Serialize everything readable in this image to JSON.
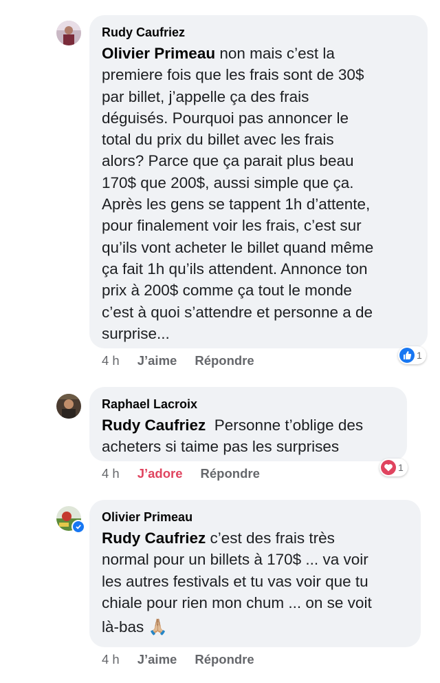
{
  "comments": [
    {
      "author": "Rudy Caufriez",
      "mention": "Olivier Primeau",
      "lines": [
        " non mais c’est la",
        "premiere fois que les frais sont de 30$",
        "par billet, j’appelle ça des frais",
        "déguisés. Pourquoi pas annoncer le",
        "total du prix du billet avec les frais",
        "alors? Parce que ça parait plus beau",
        "170$ que 200$, aussi simple que ça.",
        "Après les gens se tappent 1h d’attente,",
        "pour finalement voir les frais, c’est sur",
        "qu’ils vont acheter le billet quand même",
        "ça fait 1h qu’ils attendent. Annonce ton",
        "prix à 200$ comme ça tout le monde",
        "c’est à quoi s’attendre et personne a de",
        "surprise..."
      ],
      "time": "4 h",
      "like_label": "J’aime",
      "reply_label": "Répondre",
      "reaction": {
        "type": "like",
        "count": "1",
        "color": "#1877f2",
        "icon": "thumbs-up-icon"
      }
    },
    {
      "author": "Raphael Lacroix",
      "mention": "Rudy Caufriez",
      "lines": [
        "  Personne t’oblige des",
        "acheters si taime pas les surprises"
      ],
      "time": "4 h",
      "like_label": "J’adore",
      "reply_label": "Répondre",
      "reaction": {
        "type": "love",
        "count": "1",
        "color": "#e0445f",
        "icon": "heart-icon"
      }
    },
    {
      "author": "Olivier Primeau",
      "mention": "Rudy Caufriez",
      "lines": [
        " c’est des frais très",
        "normal pour un billets à 170$ ... va voir",
        "les autres festivals et tu vas voir que tu",
        "chiale pour rien mon chum ... on se voit",
        "là-bas 🙏🏼"
      ],
      "time": "4 h",
      "like_label": "J’aime",
      "reply_label": "Répondre",
      "verified": true
    }
  ]
}
